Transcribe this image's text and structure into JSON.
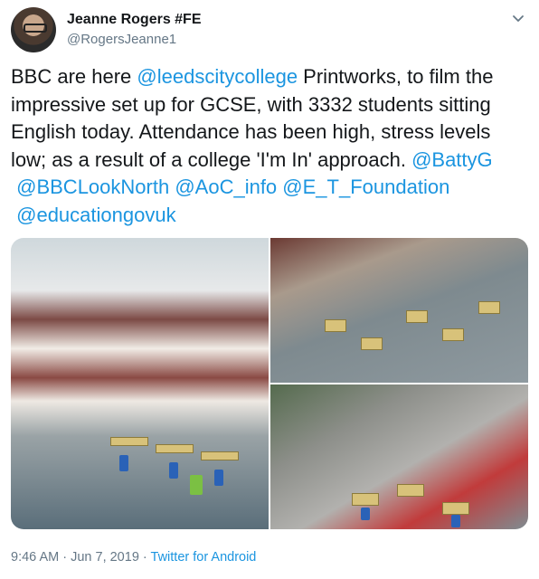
{
  "author": {
    "name": "Jeanne Rogers #FE",
    "handle": "@RogersJeanne1"
  },
  "tweet": {
    "text_part1": "BBC are here ",
    "mention1": "@leedscitycollege",
    "text_part2": " Printworks, to film the impressive set up for GCSE, with 3332 students sitting English today. Attendance has been high, stress levels low; as a result of a college 'I'm In' approach. ",
    "mention2": "@BattyG",
    "mention3": "@BBCLookNorth",
    "mention4": "@AoC_info",
    "mention5": "@E_T_Foundation",
    "mention6": "@educationgovuk"
  },
  "footer": {
    "time": "9:46 AM",
    "dot1": " · ",
    "date": "Jun 7, 2019",
    "dot2": " · ",
    "source": "Twitter for Android"
  },
  "icons": {
    "menu": "chevron-down-icon"
  },
  "colors": {
    "link": "#1b95e0",
    "secondary_text": "#657786"
  }
}
